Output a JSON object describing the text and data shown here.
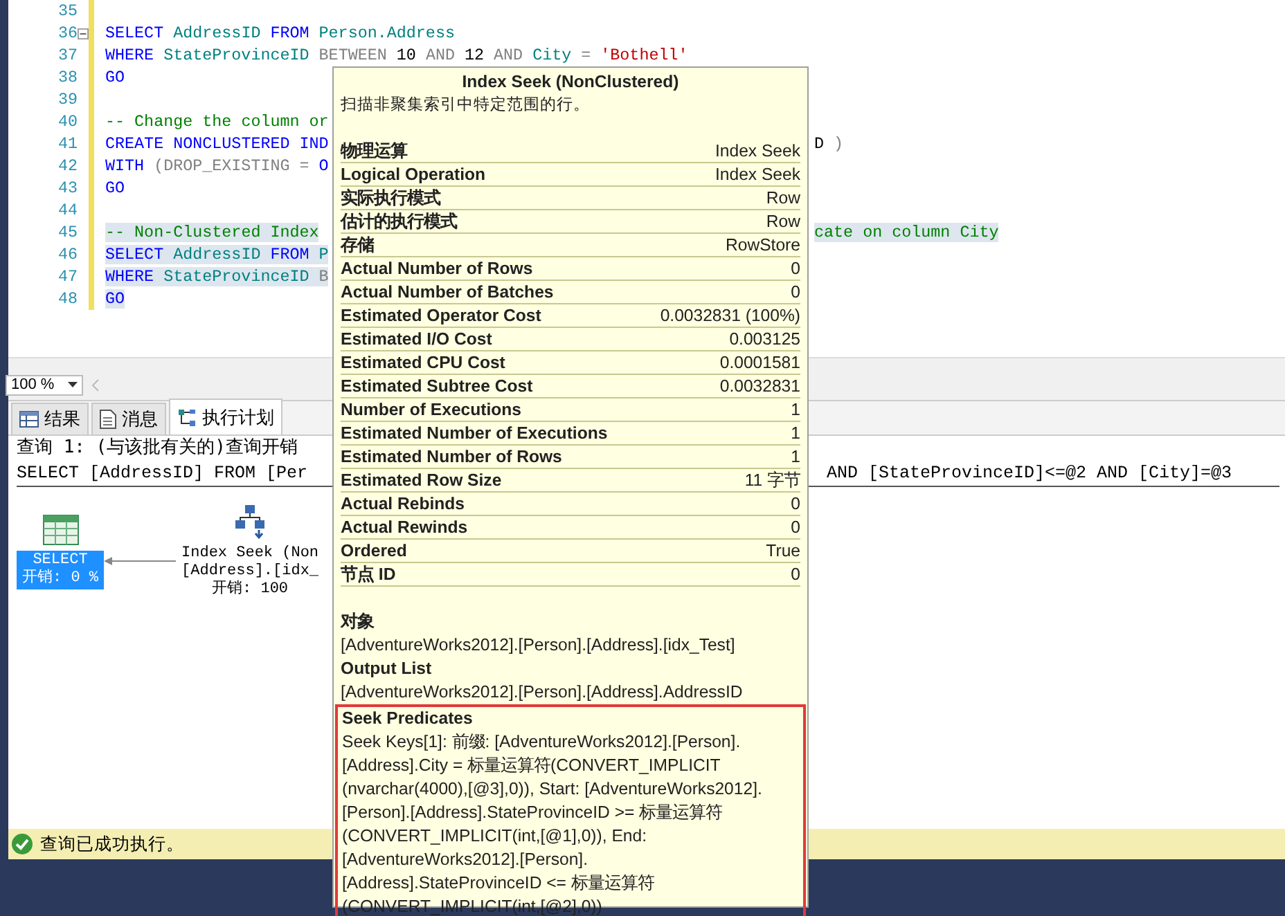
{
  "editor": {
    "lines": [
      {
        "num": "35",
        "fold": false
      },
      {
        "num": "36",
        "fold": true,
        "highlighted": false,
        "tokens": [
          {
            "t": "SELECT",
            "kind": "kw"
          },
          {
            "t": "AddressID",
            "kind": "id"
          },
          {
            "t": "FROM",
            "kind": "kw"
          },
          {
            "t": "Person.Address",
            "kind": "id"
          }
        ]
      },
      {
        "num": "37",
        "fold": false,
        "highlighted": false,
        "tokens": [
          {
            "t": "WHERE",
            "kind": "kw"
          },
          {
            "t": "StateProvinceID",
            "kind": "id"
          },
          {
            "t": "BETWEEN",
            "kind": "op"
          },
          {
            "t": "10",
            "kind": "num"
          },
          {
            "t": "AND",
            "kind": "op"
          },
          {
            "t": "12",
            "kind": "num"
          },
          {
            "t": "AND",
            "kind": "op"
          },
          {
            "t": "City",
            "kind": "id"
          },
          {
            "t": "=",
            "kind": "op"
          },
          {
            "t": "'Bothell'",
            "kind": "str"
          }
        ]
      },
      {
        "num": "38",
        "fold": false,
        "highlighted": false,
        "tokens": [
          {
            "t": "GO",
            "kind": "kw"
          }
        ]
      },
      {
        "num": "39",
        "fold": false
      },
      {
        "num": "40",
        "fold": false,
        "highlighted": false,
        "tokens": [
          {
            "t": "-- Change the column or",
            "kind": "cm"
          }
        ]
      },
      {
        "num": "41",
        "fold": false,
        "highlighted": false,
        "tokens": [
          {
            "t": "CREATE",
            "kind": "kw"
          },
          {
            "t": "NONCLUSTERED",
            "kind": "kw"
          },
          {
            "t": "IND",
            "kind": "kw"
          }
        ],
        "tail": [
          {
            "t": "D",
            "kind": "num"
          },
          {
            "t": ")",
            "kind": "op"
          }
        ]
      },
      {
        "num": "42",
        "fold": false,
        "highlighted": false,
        "tokens": [
          {
            "t": "WITH",
            "kind": "kw"
          },
          {
            "t": "(DROP_EXISTING",
            "kind": "op"
          },
          {
            "t": "=",
            "kind": "op"
          },
          {
            "t": "O",
            "kind": "kw"
          }
        ]
      },
      {
        "num": "43",
        "fold": false,
        "highlighted": false,
        "tokens": [
          {
            "t": "GO",
            "kind": "kw"
          }
        ]
      },
      {
        "num": "44",
        "fold": false
      },
      {
        "num": "45",
        "fold": false,
        "highlighted": true,
        "tokens": [
          {
            "t": "-- Non-Clustered Index",
            "kind": "cm"
          }
        ],
        "tail": [
          {
            "t": "cate on column City",
            "kind": "cm"
          }
        ]
      },
      {
        "num": "46",
        "fold": false,
        "highlighted": true,
        "tokens": [
          {
            "t": "SELECT",
            "kind": "kw"
          },
          {
            "t": "AddressID",
            "kind": "id"
          },
          {
            "t": "FROM",
            "kind": "kw"
          },
          {
            "t": "P",
            "kind": "id"
          }
        ]
      },
      {
        "num": "47",
        "fold": false,
        "highlighted": true,
        "tokens": [
          {
            "t": "WHERE",
            "kind": "kw"
          },
          {
            "t": "StateProvinceID",
            "kind": "id"
          },
          {
            "t": "B",
            "kind": "op"
          }
        ]
      },
      {
        "num": "48",
        "fold": false,
        "highlighted": true,
        "tokens": [
          {
            "t": "GO",
            "kind": "kw"
          }
        ]
      }
    ]
  },
  "zoom": {
    "value": "100 %"
  },
  "tabs": [
    {
      "label": "结果",
      "selected": false
    },
    {
      "label": "消息",
      "selected": false
    },
    {
      "label": "执行计划",
      "selected": true
    }
  ],
  "plan": {
    "query_header": "查询 1: (与该批有关的)查询开销",
    "query_sql": "SELECT [AddressID] FROM [Per",
    "query_sql_tail": "AND [StateProvinceID]<=@2 AND [City]=@3",
    "select_node": {
      "title": "SELECT",
      "cost": "开销: 0 %",
      "selected": true
    },
    "seek_node": {
      "lines": [
        "Index Seek (Non",
        "[Address].[idx_",
        "开销: 100"
      ]
    }
  },
  "tooltip": {
    "title": "Index Seek (NonClustered)",
    "subtitle": "扫描非聚集索引中特定范围的行。",
    "rows": [
      {
        "label": "物理运算",
        "value": "Index Seek"
      },
      {
        "label": "Logical Operation",
        "value": "Index Seek"
      },
      {
        "label": "实际执行模式",
        "value": "Row"
      },
      {
        "label": "估计的执行模式",
        "value": "Row"
      },
      {
        "label": "存储",
        "value": "RowStore"
      },
      {
        "label": "Actual Number of Rows",
        "value": "0"
      },
      {
        "label": "Actual Number of Batches",
        "value": "0"
      },
      {
        "label": "Estimated Operator Cost",
        "value": "0.0032831 (100%)"
      },
      {
        "label": "Estimated I/O Cost",
        "value": "0.003125"
      },
      {
        "label": "Estimated CPU Cost",
        "value": "0.0001581"
      },
      {
        "label": "Estimated Subtree Cost",
        "value": "0.0032831"
      },
      {
        "label": "Number of Executions",
        "value": "1"
      },
      {
        "label": "Estimated Number of Executions",
        "value": "1"
      },
      {
        "label": "Estimated Number of Rows",
        "value": "1"
      },
      {
        "label": "Estimated Row Size",
        "value": "11 字节"
      },
      {
        "label": "Actual Rebinds",
        "value": "0"
      },
      {
        "label": "Actual Rewinds",
        "value": "0"
      },
      {
        "label": "Ordered",
        "value": "True"
      },
      {
        "label": "节点 ID",
        "value": "0"
      }
    ],
    "sections": [
      {
        "heading": "对象",
        "lines": [
          "[AdventureWorks2012].[Person].[Address].[idx_Test]"
        ],
        "boxed": false
      },
      {
        "heading": "Output List",
        "lines": [
          "[AdventureWorks2012].[Person].[Address].AddressID"
        ],
        "boxed": false
      },
      {
        "heading": "Seek Predicates",
        "lines": [
          "Seek Keys[1]: 前缀: [AdventureWorks2012].[Person].",
          "[Address].City = 标量运算符(CONVERT_IMPLICIT",
          "(nvarchar(4000),[@3],0)), Start: [AdventureWorks2012].",
          "[Person].[Address].StateProvinceID  >= 标量运算符",
          "(CONVERT_IMPLICIT(int,[@1],0)), End:",
          "[AdventureWorks2012].[Person].",
          "[Address].StateProvinceID  <= 标量运算符",
          "(CONVERT_IMPLICIT(int,[@2],0))"
        ],
        "boxed": true
      }
    ]
  },
  "status_bar": {
    "text": "查询已成功执行。"
  }
}
